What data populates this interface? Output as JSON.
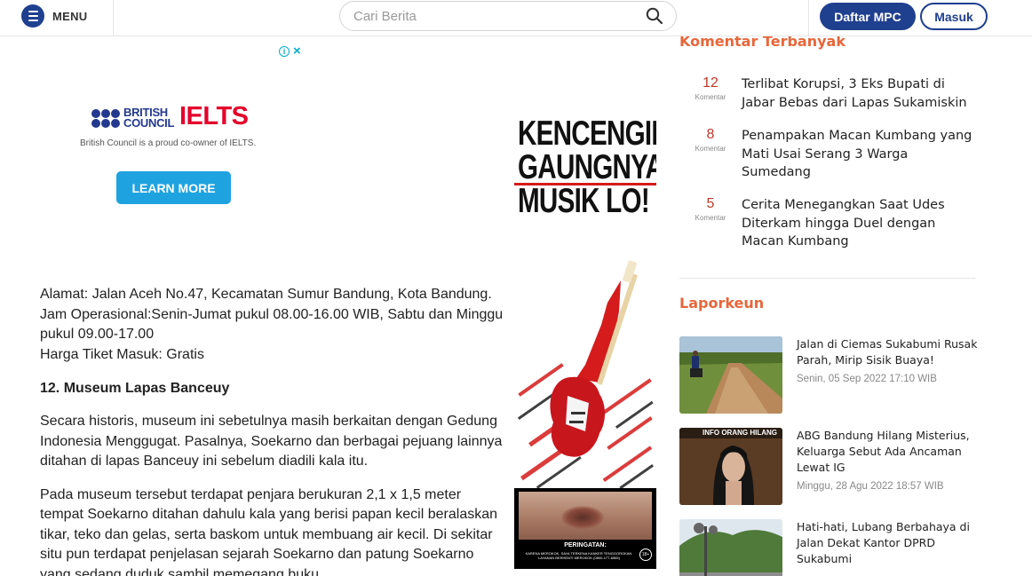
{
  "header": {
    "menu_label": "MENU",
    "search_placeholder": "Cari Berita",
    "register_label": "Daftar MPC",
    "login_label": "Masuk"
  },
  "ad": {
    "brand_line1": "BRITISH",
    "brand_line2": "COUNCIL",
    "product": "IELTS",
    "tagline": "British Council is a proud co-owner of IELTS.",
    "cta": "LEARN MORE",
    "poster_headline": [
      "KENCENGIN",
      "GAUNGNYA",
      "MUSIK LO!"
    ],
    "warning_title": "PERINGATAN:",
    "warning_body": "KARENA MEROKOK, SAYA TERKENA KANKER TENGGOROKAN. LAYANAN BERHENTI MEROKOK (0800-177-6565)",
    "age_badge": "18+"
  },
  "article": {
    "address": "Alamat: Jalan Aceh No.47, Kecamatan Sumur Bandung, Kota Bandung.",
    "hours": "Jam Operasional:Senin-Jumat pukul 08.00-16.00 WIB, Sabtu dan Minggu pukul 09.00-17.00",
    "ticket": "Harga Tiket Masuk: Gratis",
    "heading": "12. Museum Lapas Banceuy",
    "para1": "Secara historis, museum ini sebetulnya masih berkaitan dengan Gedung Indonesia Menggugat. Pasalnya, Soekarno dan berbagai pejuang lainnya ditahan di lapas Banceuy ini sebelum diadili kala itu.",
    "para2": "Pada museum tersebut terdapat penjara berukuran 2,1 x 1,5 meter tempat Soekarno ditahan dahulu kala yang berisi papan kecil beralaskan tikar, teko dan gelas, serta baskom untuk membuang air kecil. Di sekitar situ pun terdapat penjelasan sejarah Soekarno dan patung Soekarno yang sedang duduk sambil memegang buku."
  },
  "sidebar": {
    "comments_title": "Komentar Terbanyak",
    "comment_label": "Komentar",
    "comments": [
      {
        "count": "12",
        "title": "Terlibat Korupsi, 3 Eks Bupati di Jabar Bebas dari Lapas Sukamiskin"
      },
      {
        "count": "8",
        "title": "Penampakan Macan Kumbang yang Mati Usai Serang 3 Warga Sumedang"
      },
      {
        "count": "5",
        "title": "Cerita Menegangkan Saat Udes Diterkam hingga Duel dengan Macan Kumbang"
      }
    ],
    "laporkeun_title": "Laporkeun",
    "laporkeun": [
      {
        "title": "Jalan di Ciemas Sukabumi Rusak Parah, Mirip Sisik Buaya!",
        "date": "Senin, 05 Sep 2022 17:10 WIB"
      },
      {
        "title": "ABG Bandung Hilang Misterius, Keluarga Sebut Ada Ancaman Lewat IG",
        "date": "Minggu, 28 Agu 2022 18:57 WIB",
        "thumb_caption": "INFO ORANG HILANG"
      },
      {
        "title": "Hati-hati, Lubang Berbahaya di Jalan Dekat Kantor DPRD Sukabumi",
        "date": ""
      }
    ]
  },
  "colors": {
    "brand_blue": "#1f3f8f",
    "accent_orange": "#e8663a",
    "count_red": "#c0392b",
    "ielts_red": "#e4002b",
    "cta_blue": "#1fa3e0"
  }
}
